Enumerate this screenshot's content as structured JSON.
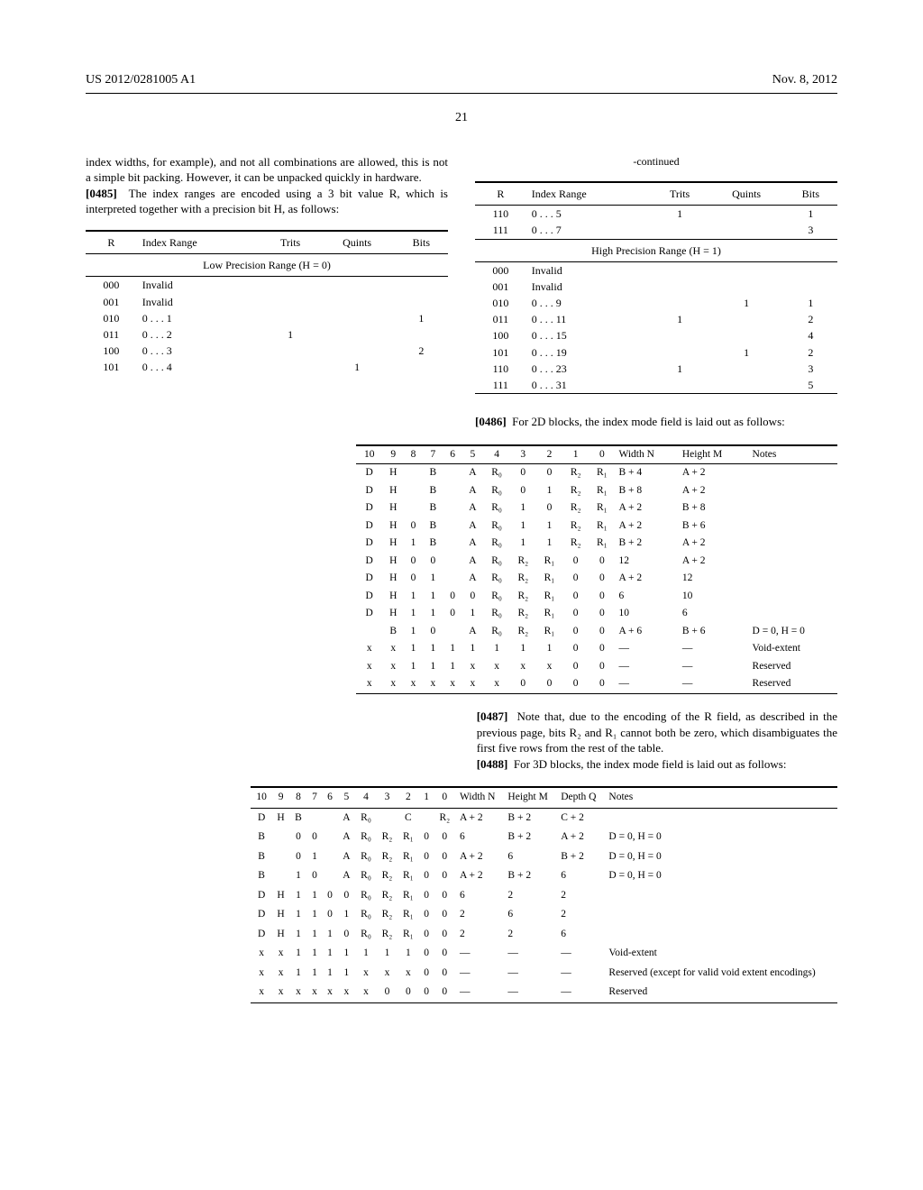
{
  "header": {
    "pubno": "US 2012/0281005 A1",
    "date": "Nov. 8, 2012"
  },
  "pageno": "21",
  "left": {
    "lead": "index widths, for example), and not all combinations are allowed, this is not a simple bit packing. However, it can be unpacked quickly in hardware.",
    "p0485": "The index ranges are encoded using a 3 bit value R, which is interpreted together with a precision bit H, as follows:",
    "table1": {
      "head": [
        "R",
        "Index Range",
        "Trits",
        "Quints",
        "Bits"
      ],
      "section": "Low Precision Range (H = 0)",
      "rows": [
        [
          "000",
          "Invalid",
          "",
          "",
          ""
        ],
        [
          "001",
          "Invalid",
          "",
          "",
          ""
        ],
        [
          "010",
          "0 . . . 1",
          "",
          "",
          "1"
        ],
        [
          "011",
          "0 . . . 2",
          "1",
          "",
          ""
        ],
        [
          "100",
          "0 . . . 3",
          "",
          "",
          "2"
        ],
        [
          "101",
          "0 . . . 4",
          "",
          "1",
          ""
        ]
      ]
    }
  },
  "right": {
    "continued": "-continued",
    "table2": {
      "head": [
        "R",
        "Index Range",
        "Trits",
        "Quints",
        "Bits"
      ],
      "rows_a": [
        [
          "110",
          "0 . . . 5",
          "1",
          "",
          "1"
        ],
        [
          "111",
          "0 . . . 7",
          "",
          "",
          "3"
        ]
      ],
      "section": "High Precision Range (H = 1)",
      "rows_b": [
        [
          "000",
          "Invalid",
          "",
          "",
          ""
        ],
        [
          "001",
          "Invalid",
          "",
          "",
          ""
        ],
        [
          "010",
          "0 . . . 9",
          "",
          "1",
          "1"
        ],
        [
          "011",
          "0 . . . 11",
          "1",
          "",
          "2"
        ],
        [
          "100",
          "0 . . . 15",
          "",
          "",
          "4"
        ],
        [
          "101",
          "0 . . . 19",
          "",
          "1",
          "2"
        ],
        [
          "110",
          "0 . . . 23",
          "1",
          "",
          "3"
        ],
        [
          "111",
          "0 . . . 31",
          "",
          "",
          "5"
        ]
      ]
    },
    "p0486": "For 2D blocks, the index mode field is laid out as follows:"
  },
  "table2d": {
    "head": [
      "10",
      "9",
      "8",
      "7",
      "6",
      "5",
      "4",
      "3",
      "2",
      "1",
      "0",
      "Width N",
      "Height M",
      "Notes"
    ],
    "rows": [
      [
        "D",
        "H",
        "",
        "B",
        "",
        "A",
        "R₀",
        "0",
        "0",
        "R₂",
        "R₁",
        "B + 4",
        "A + 2",
        ""
      ],
      [
        "D",
        "H",
        "",
        "B",
        "",
        "A",
        "R₀",
        "0",
        "1",
        "R₂",
        "R₁",
        "B + 8",
        "A + 2",
        ""
      ],
      [
        "D",
        "H",
        "",
        "B",
        "",
        "A",
        "R₀",
        "1",
        "0",
        "R₂",
        "R₁",
        "A + 2",
        "B + 8",
        ""
      ],
      [
        "D",
        "H",
        "0",
        "B",
        "",
        "A",
        "R₀",
        "1",
        "1",
        "R₂",
        "R₁",
        "A + 2",
        "B + 6",
        ""
      ],
      [
        "D",
        "H",
        "1",
        "B",
        "",
        "A",
        "R₀",
        "1",
        "1",
        "R₂",
        "R₁",
        "B + 2",
        "A + 2",
        ""
      ],
      [
        "D",
        "H",
        "0",
        "0",
        "",
        "A",
        "R₀",
        "R₂",
        "R₁",
        "0",
        "0",
        "12",
        "A + 2",
        ""
      ],
      [
        "D",
        "H",
        "0",
        "1",
        "",
        "A",
        "R₀",
        "R₂",
        "R₁",
        "0",
        "0",
        "A + 2",
        "12",
        ""
      ],
      [
        "D",
        "H",
        "1",
        "1",
        "0",
        "0",
        "R₀",
        "R₂",
        "R₁",
        "0",
        "0",
        "6",
        "10",
        ""
      ],
      [
        "D",
        "H",
        "1",
        "1",
        "0",
        "1",
        "R₀",
        "R₂",
        "R₁",
        "0",
        "0",
        "10",
        "6",
        ""
      ],
      [
        "",
        "B",
        "1",
        "0",
        "",
        "A",
        "R₀",
        "R₂",
        "R₁",
        "0",
        "0",
        "A + 6",
        "B + 6",
        "D = 0, H = 0"
      ],
      [
        "x",
        "x",
        "1",
        "1",
        "1",
        "1",
        "1",
        "1",
        "1",
        "0",
        "0",
        "—",
        "—",
        "Void-extent"
      ],
      [
        "x",
        "x",
        "1",
        "1",
        "1",
        "x",
        "x",
        "x",
        "x",
        "0",
        "0",
        "—",
        "—",
        "Reserved"
      ],
      [
        "x",
        "x",
        "x",
        "x",
        "x",
        "x",
        "x",
        "0",
        "0",
        "0",
        "0",
        "—",
        "—",
        "Reserved"
      ]
    ]
  },
  "mid": {
    "p0487": "Note that, due to the encoding of the R field, as described in the previous page, bits R₂ and R₁ cannot both be zero, which disambiguates the first five rows from the rest of the table.",
    "p0488": "For 3D blocks, the index mode field is laid out as follows:"
  },
  "table3d": {
    "head": [
      "10",
      "9",
      "8",
      "7",
      "6",
      "5",
      "4",
      "3",
      "2",
      "1",
      "0",
      "Width N",
      "Height M",
      "Depth Q",
      "Notes"
    ],
    "rows": [
      {
        "c": [
          [
            "D",
            "H"
          ],
          [
            "B",
            ""
          ],
          [
            "",
            "A"
          ],
          [
            "R₀",
            ""
          ],
          [
            "C",
            ""
          ],
          [
            "R₂",
            "R₁"
          ]
        ],
        "w": "A + 2",
        "h": "B + 2",
        "d": "C + 2",
        "n": ""
      },
      {
        "c": [
          [
            "B",
            ""
          ],
          [
            "0",
            "0"
          ],
          [
            "",
            "A"
          ],
          [
            "R₀",
            "R₂"
          ],
          [
            "R₁",
            "0"
          ],
          [
            "0",
            ""
          ]
        ],
        "w": "6",
        "h": "B + 2",
        "d": "A + 2",
        "n": "D = 0, H = 0"
      },
      {
        "c": [
          [
            "B",
            ""
          ],
          [
            "0",
            "1"
          ],
          [
            "",
            "A"
          ],
          [
            "R₀",
            "R₂"
          ],
          [
            "R₁",
            "0"
          ],
          [
            "0",
            ""
          ]
        ],
        "w": "A + 2",
        "h": "6",
        "d": "B + 2",
        "n": "D = 0, H = 0"
      },
      {
        "c": [
          [
            "B",
            ""
          ],
          [
            "1",
            "0"
          ],
          [
            "",
            "A"
          ],
          [
            "R₀",
            "R₂"
          ],
          [
            "R₁",
            "0"
          ],
          [
            "0",
            ""
          ]
        ],
        "w": "A + 2",
        "h": "B + 2",
        "d": "6",
        "n": "D = 0, H = 0"
      },
      {
        "c": [
          [
            "D",
            "H"
          ],
          [
            "1",
            "1"
          ],
          [
            "0",
            "0"
          ],
          [
            "R₀",
            "R₂"
          ],
          [
            "R₁",
            "0"
          ],
          [
            "0",
            ""
          ]
        ],
        "w": "6",
        "h": "2",
        "d": "2",
        "n": ""
      },
      {
        "c": [
          [
            "D",
            "H"
          ],
          [
            "1",
            "1"
          ],
          [
            "0",
            "1"
          ],
          [
            "R₀",
            "R₂"
          ],
          [
            "R₁",
            "0"
          ],
          [
            "0",
            ""
          ]
        ],
        "w": "2",
        "h": "6",
        "d": "2",
        "n": ""
      },
      {
        "c": [
          [
            "D",
            "H"
          ],
          [
            "1",
            "1"
          ],
          [
            "1",
            "0"
          ],
          [
            "R₀",
            "R₂"
          ],
          [
            "R₁",
            "0"
          ],
          [
            "0",
            ""
          ]
        ],
        "w": "2",
        "h": "2",
        "d": "6",
        "n": ""
      },
      {
        "c": [
          [
            "x",
            "x"
          ],
          [
            "1",
            "1"
          ],
          [
            "1",
            "1"
          ],
          [
            "1",
            "1"
          ],
          [
            "1",
            "0"
          ],
          [
            "0",
            ""
          ]
        ],
        "w": "—",
        "h": "—",
        "d": "—",
        "n": "Void-extent"
      },
      {
        "c": [
          [
            "x",
            "x"
          ],
          [
            "1",
            "1"
          ],
          [
            "1",
            "1"
          ],
          [
            "x",
            "x"
          ],
          [
            "x",
            "0"
          ],
          [
            "0",
            ""
          ]
        ],
        "w": "—",
        "h": "—",
        "d": "—",
        "n": "Reserved (except for valid void extent encodings)"
      },
      {
        "c": [
          [
            "x",
            "x"
          ],
          [
            "x",
            "x"
          ],
          [
            "x",
            "x"
          ],
          [
            "x",
            "0"
          ],
          [
            "0",
            "0"
          ],
          [
            "0",
            ""
          ]
        ],
        "w": "—",
        "h": "—",
        "d": "—",
        "n": "Reserved"
      }
    ]
  }
}
